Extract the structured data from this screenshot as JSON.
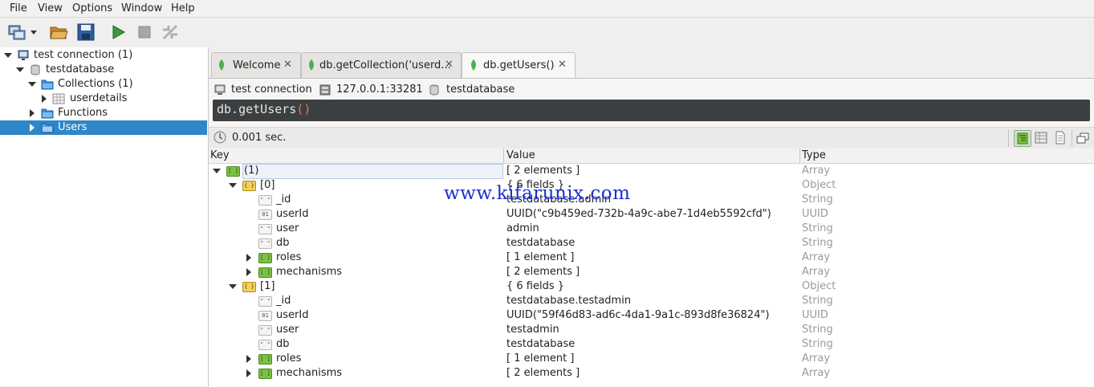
{
  "menu": [
    "File",
    "View",
    "Options",
    "Window",
    "Help"
  ],
  "toolbar": {
    "icons": [
      "connect-icon",
      "dropdown-icon",
      "open-icon",
      "save-icon",
      "execute-icon",
      "stop-icon",
      "disconnect-icon"
    ]
  },
  "sidebar": {
    "items": [
      {
        "label": "test connection (1)",
        "icon": "computer-icon"
      },
      {
        "label": "testdatabase",
        "icon": "database-icon"
      },
      {
        "label": "Collections (1)",
        "icon": "folder-icon"
      },
      {
        "label": "userdetails",
        "icon": "table-icon"
      },
      {
        "label": "Functions",
        "icon": "folder-icon"
      },
      {
        "label": "Users",
        "icon": "folder-icon"
      }
    ]
  },
  "tabs": [
    {
      "label": "Welcome"
    },
    {
      "label": "db.getCollection('userd..."
    },
    {
      "label": "db.getUsers()"
    }
  ],
  "connection": {
    "name": "test connection",
    "address": "127.0.0.1:33281",
    "database": "testdatabase"
  },
  "query": {
    "text": "db.getUsers",
    "parens": "()"
  },
  "status": {
    "time": "0.001 sec."
  },
  "table": {
    "headers": {
      "key": "Key",
      "value": "Value",
      "type": "Type"
    },
    "rows": [
      {
        "key": "(1)",
        "value": "[ 2 elements ]",
        "type": "Array"
      },
      {
        "key": "[0]",
        "value": "{ 6 fields }",
        "type": "Object"
      },
      {
        "key": "_id",
        "value": "testdatabase.admin",
        "type": "String"
      },
      {
        "key": "userId",
        "value": "UUID(\"c9b459ed-732b-4a9c-abe7-1d4eb5592cfd\")",
        "type": "UUID"
      },
      {
        "key": "user",
        "value": "admin",
        "type": "String"
      },
      {
        "key": "db",
        "value": "testdatabase",
        "type": "String"
      },
      {
        "key": "roles",
        "value": "[ 1 element ]",
        "type": "Array"
      },
      {
        "key": "mechanisms",
        "value": "[ 2 elements ]",
        "type": "Array"
      },
      {
        "key": "[1]",
        "value": "{ 6 fields }",
        "type": "Object"
      },
      {
        "key": "_id",
        "value": "testdatabase.testadmin",
        "type": "String"
      },
      {
        "key": "userId",
        "value": "UUID(\"59f46d83-ad6c-4da1-9a1c-893d8fe36824\")",
        "type": "UUID"
      },
      {
        "key": "user",
        "value": "testadmin",
        "type": "String"
      },
      {
        "key": "db",
        "value": "testdatabase",
        "type": "String"
      },
      {
        "key": "roles",
        "value": "[ 1 element ]",
        "type": "Array"
      },
      {
        "key": "mechanisms",
        "value": "[ 2 elements ]",
        "type": "Array"
      }
    ]
  },
  "watermark": "www.kifarunix.com",
  "colors": {
    "selection": "#2f86c8",
    "query_bg": "#3c3f41",
    "array_icon": "#7cc242",
    "object_icon": "#f0d060"
  }
}
